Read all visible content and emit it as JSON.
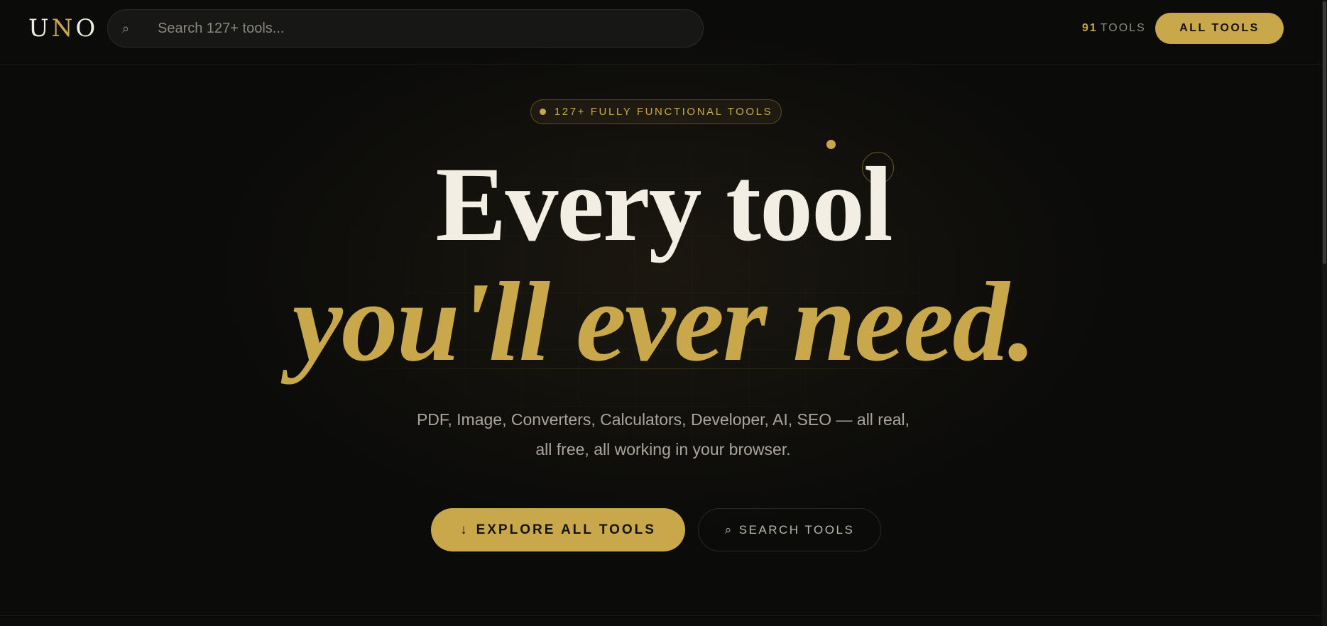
{
  "header": {
    "logo": {
      "u": "U",
      "n": "N",
      "o": "O"
    },
    "search_placeholder": "Search 127+ tools...",
    "search_icon": "search-icon",
    "tool_count_number": "91",
    "tool_count_label": "TOOLS",
    "all_tools_label": "ALL TOOLS"
  },
  "hero": {
    "badge": "127+ FULLY FUNCTIONAL TOOLS",
    "headline_line1": "Every tool",
    "headline_line2": "you'll ever need.",
    "subtitle": "PDF, Image, Converters, Calculators, Developer, AI, SEO — all real, all free, all working in your browser.",
    "explore_icon": "↓",
    "explore_label": "EXPLORE ALL TOOLS",
    "search_icon": "⌕",
    "search_label": "SEARCH TOOLS"
  },
  "colors": {
    "accent": "#c9a84c",
    "background": "#0b0b0a",
    "headline": "#f2eee4"
  }
}
